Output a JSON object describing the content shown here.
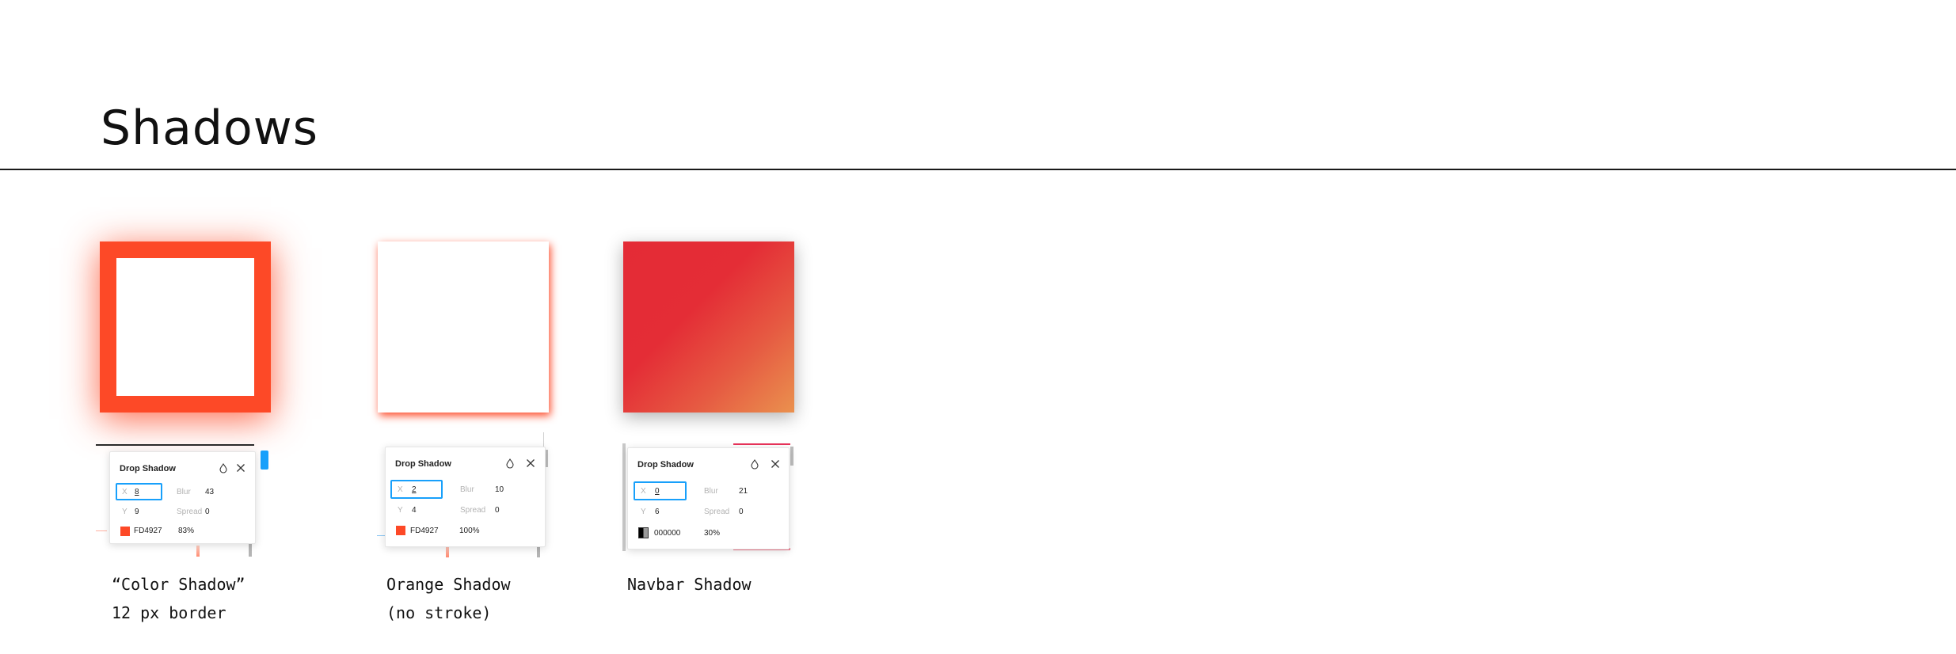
{
  "page": {
    "title": "Shadows"
  },
  "samples": [
    {
      "caption_line1": "“Color Shadow”",
      "caption_line2": "12 px border",
      "panel": {
        "title": "Drop Shadow",
        "x_label": "X",
        "x_value": "8",
        "y_label": "Y",
        "y_value": "9",
        "blur_label": "Blur",
        "blur_value": "43",
        "spread_label": "Spread",
        "spread_value": "0",
        "color_hex": "FD4927",
        "opacity": "83%",
        "swatch_color": "#FD4927"
      }
    },
    {
      "caption_line1": "Orange Shadow",
      "caption_line2": "(no stroke)",
      "panel": {
        "title": "Drop Shadow",
        "x_label": "X",
        "x_value": "2",
        "y_label": "Y",
        "y_value": "4",
        "blur_label": "Blur",
        "blur_value": "10",
        "spread_label": "Spread",
        "spread_value": "0",
        "color_hex": "FD4927",
        "opacity": "100%",
        "swatch_color": "#FD4927"
      }
    },
    {
      "caption_line1": "Navbar Shadow",
      "caption_line2": "",
      "panel": {
        "title": "Drop Shadow",
        "x_label": "X",
        "x_value": "0",
        "y_label": "Y",
        "y_value": "6",
        "blur_label": "Blur",
        "blur_value": "21",
        "spread_label": "Spread",
        "spread_value": "0",
        "color_hex": "000000",
        "opacity": "30%",
        "swatch_color": "#000000"
      }
    }
  ],
  "colors": {
    "accent": "#FD4927",
    "focus": "#18a0fb",
    "gradient_start": "#e42b36",
    "gradient_end": "#ea914e"
  },
  "icons": {
    "style": "style-drop-icon",
    "close": "close-icon"
  }
}
